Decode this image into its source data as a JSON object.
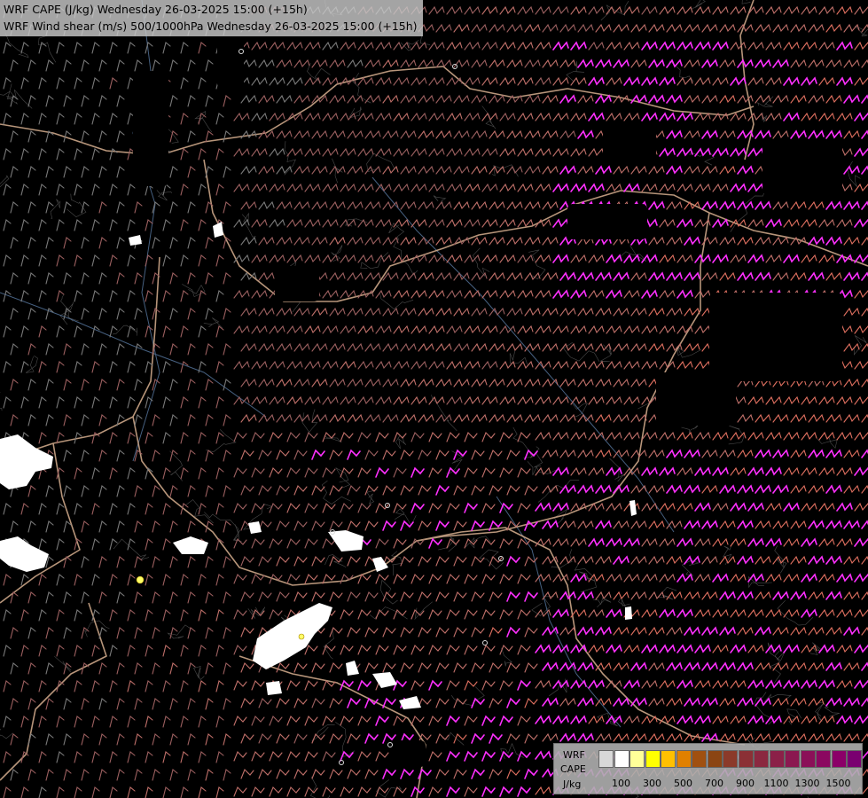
{
  "header": {
    "title_line1": "WRF CAPE (J/kg) Wednesday 26-03-2025 15:00 (+15h)",
    "title_line2": "WRF Wind shear (m/s) 500/1000hPa Wednesday 26-03-2025 15:00 (+15h)"
  },
  "legend": {
    "line1": "WRF",
    "line2": "CAPE",
    "unit": "J/kg",
    "colors": [
      "#d8d8d8",
      "#ffffff",
      "#ffff99",
      "#ffff00",
      "#ffc000",
      "#e08000",
      "#a05010",
      "#8b4513",
      "#8b3a2a",
      "#8b3035",
      "#8b2840",
      "#8b2048",
      "#8b1850",
      "#8b1058",
      "#8b0860",
      "#8b0068",
      "#7a0070"
    ],
    "ticks": [
      "100",
      "300",
      "500",
      "700",
      "900",
      "1100",
      "1300",
      "1500"
    ]
  },
  "map": {
    "background": "#000000",
    "shear_barb_colors": [
      "#7a7a7a",
      "#9c6060",
      "#c0706a",
      "#e07060",
      "#ff30ff"
    ],
    "border_color": "#d8b090",
    "river_color": "#5878a0",
    "cape_patch_color": "#ffffff"
  }
}
